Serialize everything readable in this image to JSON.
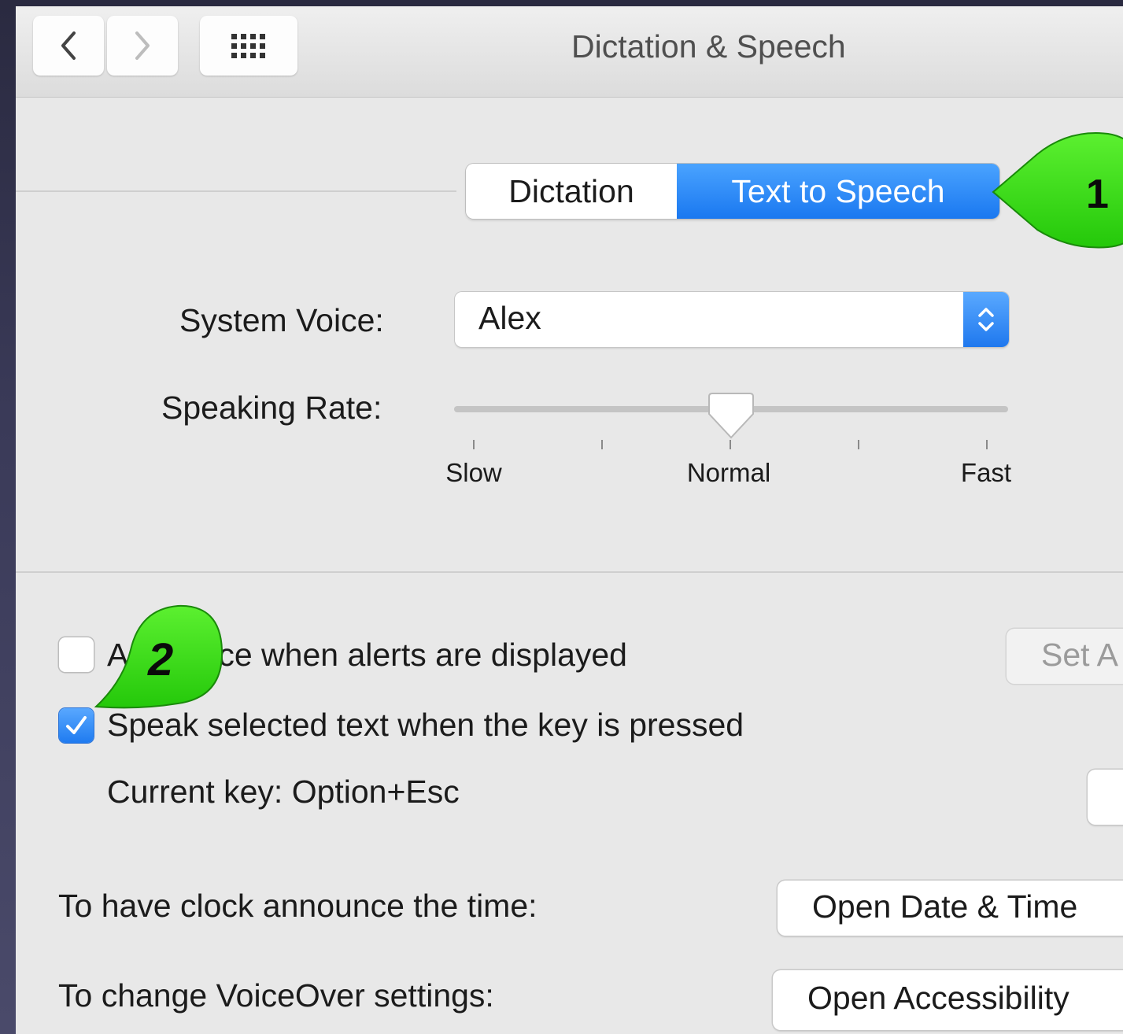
{
  "window": {
    "title": "Dictation & Speech",
    "nav": {
      "back_icon": "chevron-left-icon",
      "forward_icon": "chevron-right-icon",
      "grid_icon": "show-all-grid-icon"
    }
  },
  "tabs": [
    {
      "label": "Dictation",
      "selected": false
    },
    {
      "label": "Text to Speech",
      "selected": true
    }
  ],
  "system_voice": {
    "label": "System Voice:",
    "value": "Alex"
  },
  "speaking_rate": {
    "label": "Speaking Rate:",
    "tick_labels": [
      "Slow",
      "Normal",
      "Fast"
    ],
    "value_fraction": 0.5
  },
  "options": {
    "announce_alerts": {
      "label": "Announce when alerts are displayed",
      "checked": false
    },
    "set_alert_button": "Set A",
    "speak_selected": {
      "label": "Speak selected text when the key is pressed",
      "checked": true
    },
    "current_key": "Current key: Option+Esc"
  },
  "clock": {
    "label": "To have clock announce the time:",
    "button": "Open Date & Time"
  },
  "voiceover": {
    "label": "To change VoiceOver settings:",
    "button": "Open Accessibility"
  },
  "callouts": [
    "1",
    "2"
  ],
  "colors": {
    "accent": "#1f7bf0",
    "callout_green": "#3fe01a"
  }
}
